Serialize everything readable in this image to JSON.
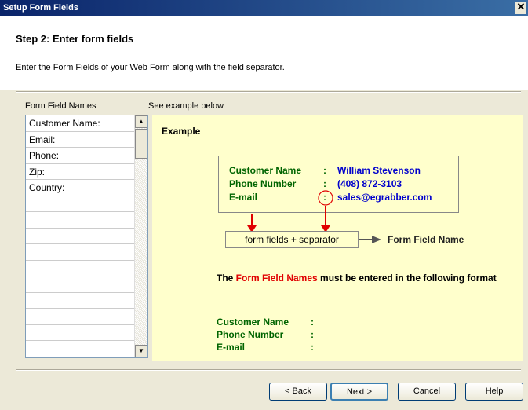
{
  "window": {
    "title": "Setup Form Fields",
    "close_label": "✕"
  },
  "header": {
    "step_title": "Step 2: Enter form fields",
    "description": "Enter the Form Fields of your Web Form along with the field separator."
  },
  "list_label": "Form Field Names",
  "example_label": "See example below",
  "fields": [
    "Customer Name:",
    "Email:",
    "Phone:",
    "Zip:",
    "Country:",
    "",
    "",
    "",
    "",
    "",
    "",
    "",
    "",
    "",
    ""
  ],
  "example": {
    "title": "Example",
    "rows": [
      {
        "name": "Customer Name",
        "sep": ":",
        "value": "William Stevenson"
      },
      {
        "name": "Phone Number",
        "sep": ":",
        "value": "(408) 872-3103"
      },
      {
        "name": "E-mail",
        "sep": ":",
        "value": "sales@egrabber.com"
      }
    ],
    "separator_box": "form fields + separator",
    "form_field_name": "Form Field Name",
    "para_prefix": "The ",
    "para_highlight": "Form Field Names",
    "para_suffix": " must be entered in the following format",
    "format_rows": [
      {
        "name": "Customer Name",
        "sep": ":"
      },
      {
        "name": "Phone Number",
        "sep": ":"
      },
      {
        "name": "E-mail",
        "sep": ":"
      }
    ]
  },
  "buttons": {
    "back": "< Back",
    "next": "Next >",
    "cancel": "Cancel",
    "help": "Help"
  },
  "colors": {
    "title_bar": "#0a246a",
    "example_bg": "#ffffcc",
    "field_green": "#006400",
    "value_blue": "#0000cc",
    "highlight_red": "#e00000"
  }
}
